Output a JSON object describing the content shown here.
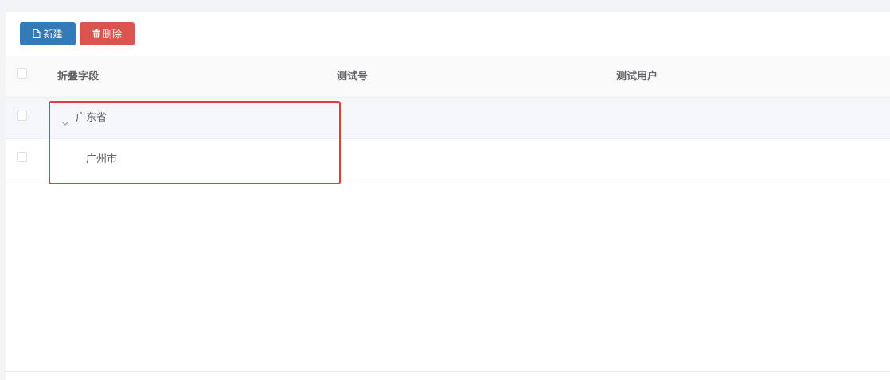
{
  "toolbar": {
    "new_label": "新建",
    "delete_label": "删除",
    "new_color": "#337ab7",
    "delete_color": "#d9534f"
  },
  "table": {
    "columns": [
      "折叠字段",
      "测试号",
      "测试用户"
    ],
    "rows": [
      {
        "label": "广东省",
        "level": 0,
        "expanded": true
      },
      {
        "label": "广州市",
        "level": 1
      }
    ]
  },
  "highlight_color": "#e23b3b",
  "icons": [
    "file-icon",
    "trash-icon",
    "chevron-down-icon"
  ]
}
